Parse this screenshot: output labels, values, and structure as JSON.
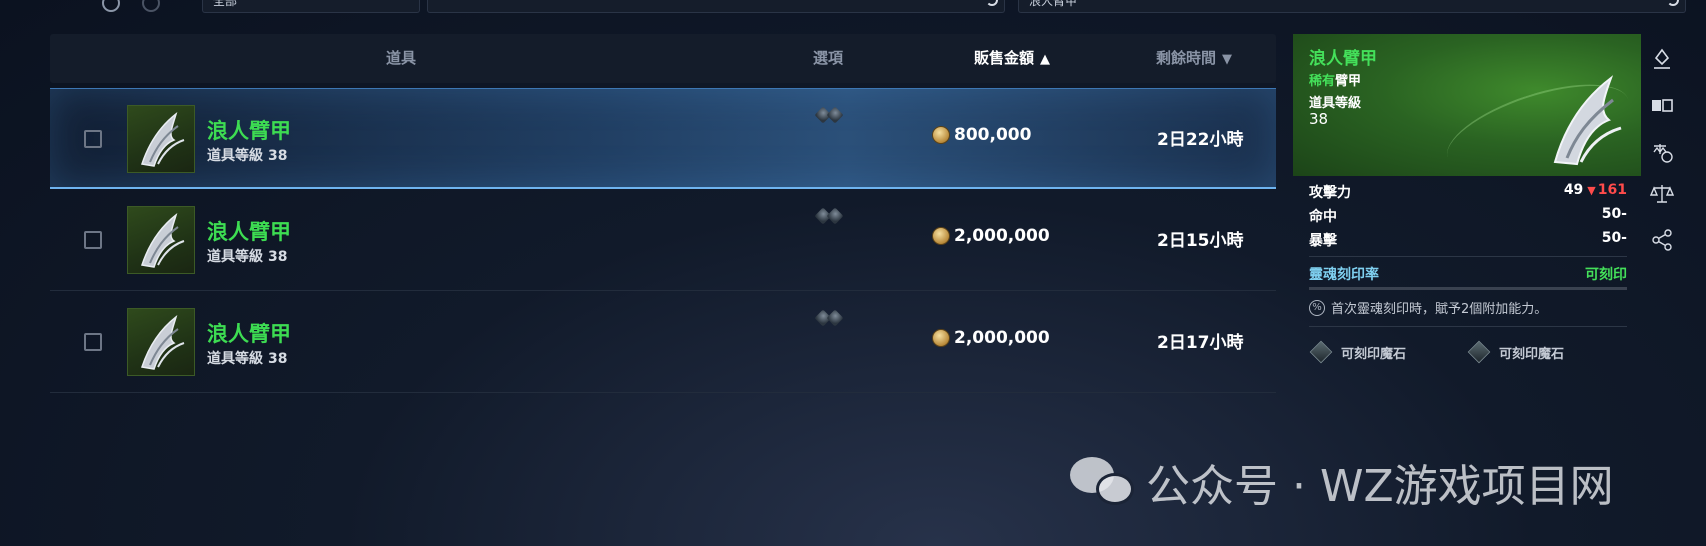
{
  "topbar": {
    "field1": "全部",
    "field2": "",
    "field3": "浪人臂甲"
  },
  "table": {
    "columns": {
      "item": "道具",
      "options": "選項",
      "price": "販售金額",
      "time": "剩餘時間"
    },
    "sort": {
      "price": "asc",
      "time": "desc"
    },
    "rows": [
      {
        "name": "浪人臂甲",
        "level_label": "道具等級",
        "level": "38",
        "price": "800,000",
        "time": "2日22小時",
        "selected": true
      },
      {
        "name": "浪人臂甲",
        "level_label": "道具等級",
        "level": "38",
        "price": "2,000,000",
        "time": "2日15小時",
        "selected": false
      },
      {
        "name": "浪人臂甲",
        "level_label": "道具等級",
        "level": "38",
        "price": "2,000,000",
        "time": "2日17小時",
        "selected": false
      }
    ]
  },
  "detail": {
    "name": "浪人臂甲",
    "rarity": "稀有",
    "type": "臂甲",
    "level_label": "道具等級",
    "level": "38",
    "stats": [
      {
        "label": "攻擊力",
        "value": "49",
        "compare": "161"
      },
      {
        "label": "命中",
        "value": "50-"
      },
      {
        "label": "暴擊",
        "value": "50-"
      }
    ],
    "engrave_label": "靈魂刻印率",
    "engrave_status": "可刻印",
    "note": "首次靈魂刻印時，賦予2個附加能力。",
    "slots": [
      "可刻印魔石",
      "可刻印魔石"
    ]
  },
  "colors": {
    "rare_green": "#44e05a",
    "price_white": "#ffffff",
    "down_red": "#ff4b4b",
    "engrave_blue": "#7fd0f0"
  },
  "side_icons": [
    "gem-marker-icon",
    "compare-cards-icon",
    "world-market-icon",
    "balance-scale-icon",
    "share-icon"
  ],
  "watermark": "公众号 · WZ游戏项目网"
}
